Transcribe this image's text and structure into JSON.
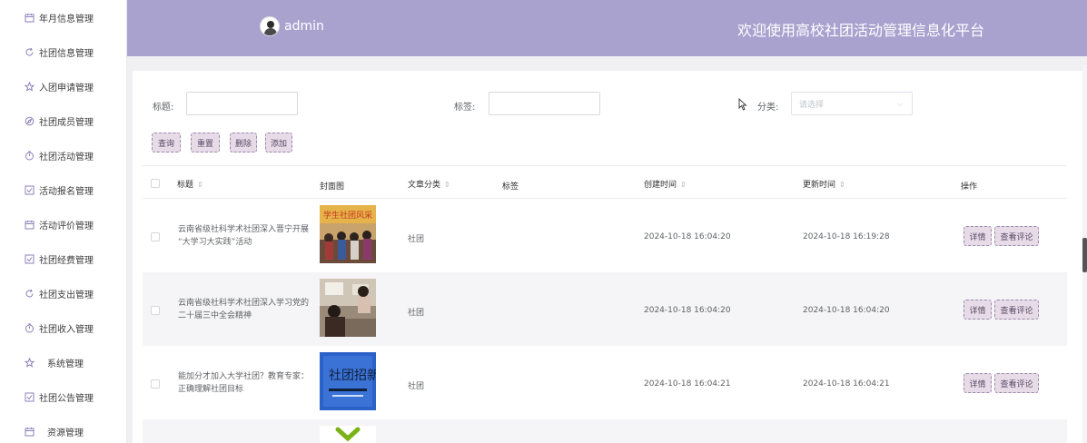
{
  "sidebar": {
    "items": [
      {
        "label": "年月信息管理",
        "icon": "calendar-icon"
      },
      {
        "label": "社团信息管理",
        "icon": "refresh-icon"
      },
      {
        "label": "入团申请管理",
        "icon": "star-icon"
      },
      {
        "label": "社团成员管理",
        "icon": "compass-icon"
      },
      {
        "label": "社团活动管理",
        "icon": "timer-icon"
      },
      {
        "label": "活动报名管理",
        "icon": "checkbox-icon"
      },
      {
        "label": "活动评价管理",
        "icon": "calendar-icon"
      },
      {
        "label": "社团经费管理",
        "icon": "checkbox-icon"
      },
      {
        "label": "社团支出管理",
        "icon": "refresh-icon"
      },
      {
        "label": "社团收入管理",
        "icon": "timer-icon"
      },
      {
        "label": "系统管理",
        "icon": "star-icon"
      },
      {
        "label": "社团公告管理",
        "icon": "checkbox-icon"
      },
      {
        "label": "资源管理",
        "icon": "calendar-icon"
      }
    ]
  },
  "header": {
    "username": "admin",
    "welcome": "欢迎使用高校社团活动管理信息化平台"
  },
  "filters": {
    "title_label": "标题:",
    "title_value": "",
    "tag_label": "标签:",
    "tag_value": "",
    "category_label": "分类:",
    "category_placeholder": "请选择"
  },
  "actions": {
    "search": "查询",
    "reset": "重置",
    "delete": "删除",
    "add": "添加"
  },
  "table": {
    "columns": {
      "title": "标题",
      "cover": "封面图",
      "category": "文章分类",
      "tags": "标签",
      "created": "创建时间",
      "updated": "更新时间",
      "ops": "操作"
    },
    "rows": [
      {
        "title_line1": "云南省级社科学术社团深入晋宁开展",
        "title_line2": "“大学习大实践”活动",
        "category": "社团",
        "tags": "",
        "created": "2024-10-18 16:04:20",
        "updated": "2024-10-18 16:19:28",
        "cover_text": "学生社团风采"
      },
      {
        "title_line1": "云南省级社科学术社团深入学习党的",
        "title_line2": "二十届三中全会精神",
        "category": "社团",
        "tags": "",
        "created": "2024-10-18 16:04:20",
        "updated": "2024-10-18 16:04:20",
        "cover_text": ""
      },
      {
        "title_line1": "能加分才加入大学社团？教育专家：",
        "title_line2": "正确理解社团目标",
        "category": "社团",
        "tags": "",
        "created": "2024-10-18 16:04:21",
        "updated": "2024-10-18 16:04:21",
        "cover_text": "社团招新"
      }
    ],
    "detail_label": "详情",
    "comments_label": "查看评论"
  },
  "colors": {
    "header_bg": "#a9a2cf",
    "button_bg": "#e6dbe6",
    "button_border": "#9a88b0"
  }
}
